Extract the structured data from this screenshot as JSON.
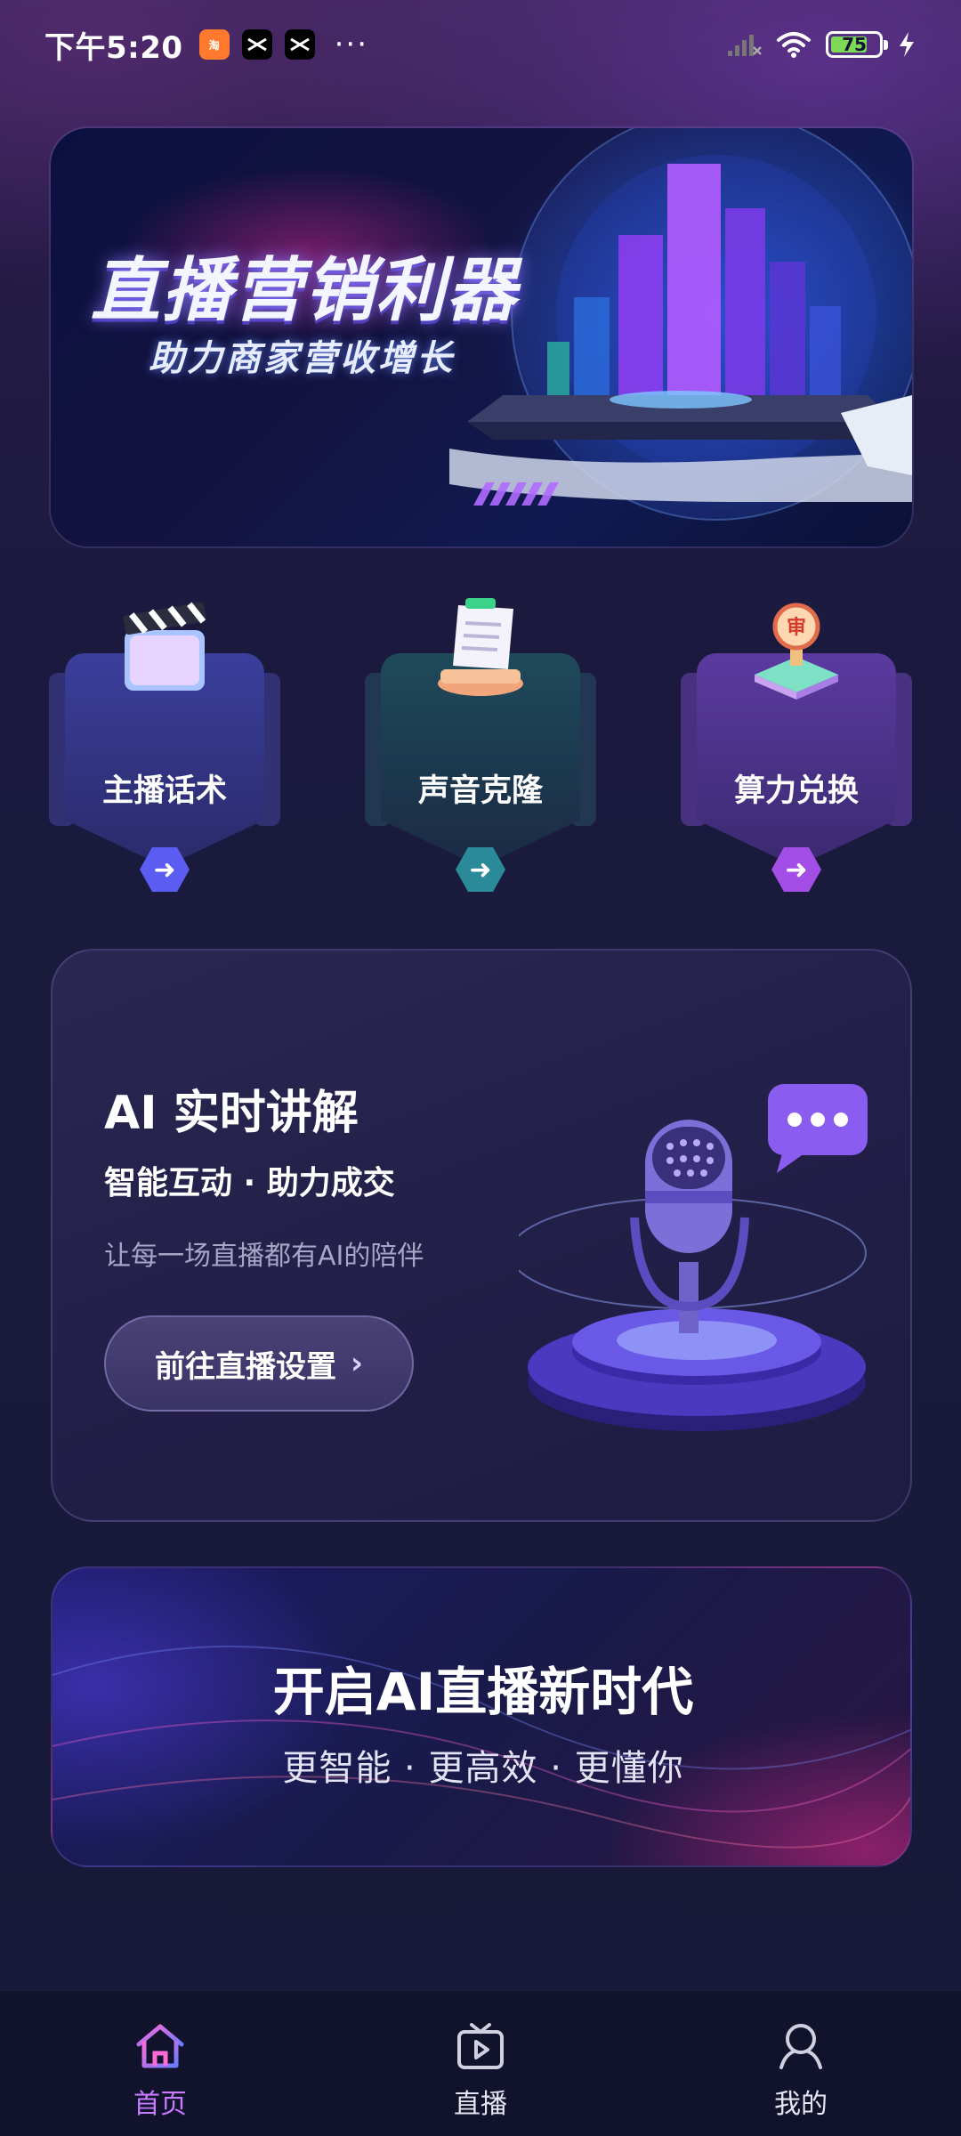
{
  "status_bar": {
    "time": "下午5:20",
    "app_icons": [
      "taobao-icon",
      "capcut-icon",
      "capcut-icon"
    ],
    "more": "···",
    "battery_level": "75"
  },
  "hero": {
    "title": "直播营销利器",
    "subtitle": "助力商家营收增长"
  },
  "features": [
    {
      "label": "主播话术",
      "icon": "clapperboard-icon",
      "accent": "#5b5cf2"
    },
    {
      "label": "声音克隆",
      "icon": "scroll-icon",
      "accent": "#2a8a9a"
    },
    {
      "label": "算力兑换",
      "icon": "seal-icon",
      "accent": "#a34ee6"
    }
  ],
  "ai_panel": {
    "title": "AI 实时讲解",
    "subtitle": "智能互动 · 助力成交",
    "description": "让每一场直播都有AI的陪伴",
    "button": "前往直播设置",
    "button_chevron": "›"
  },
  "promo": {
    "title": "开启AI直播新时代",
    "subtitle": "更智能 · 更高效 · 更懂你"
  },
  "nav": {
    "items": [
      {
        "label": "首页",
        "icon": "home-icon",
        "active": true
      },
      {
        "label": "直播",
        "icon": "tv-play-icon",
        "active": false
      },
      {
        "label": "我的",
        "icon": "user-icon",
        "active": false
      }
    ],
    "active_color": "#c77bff"
  }
}
